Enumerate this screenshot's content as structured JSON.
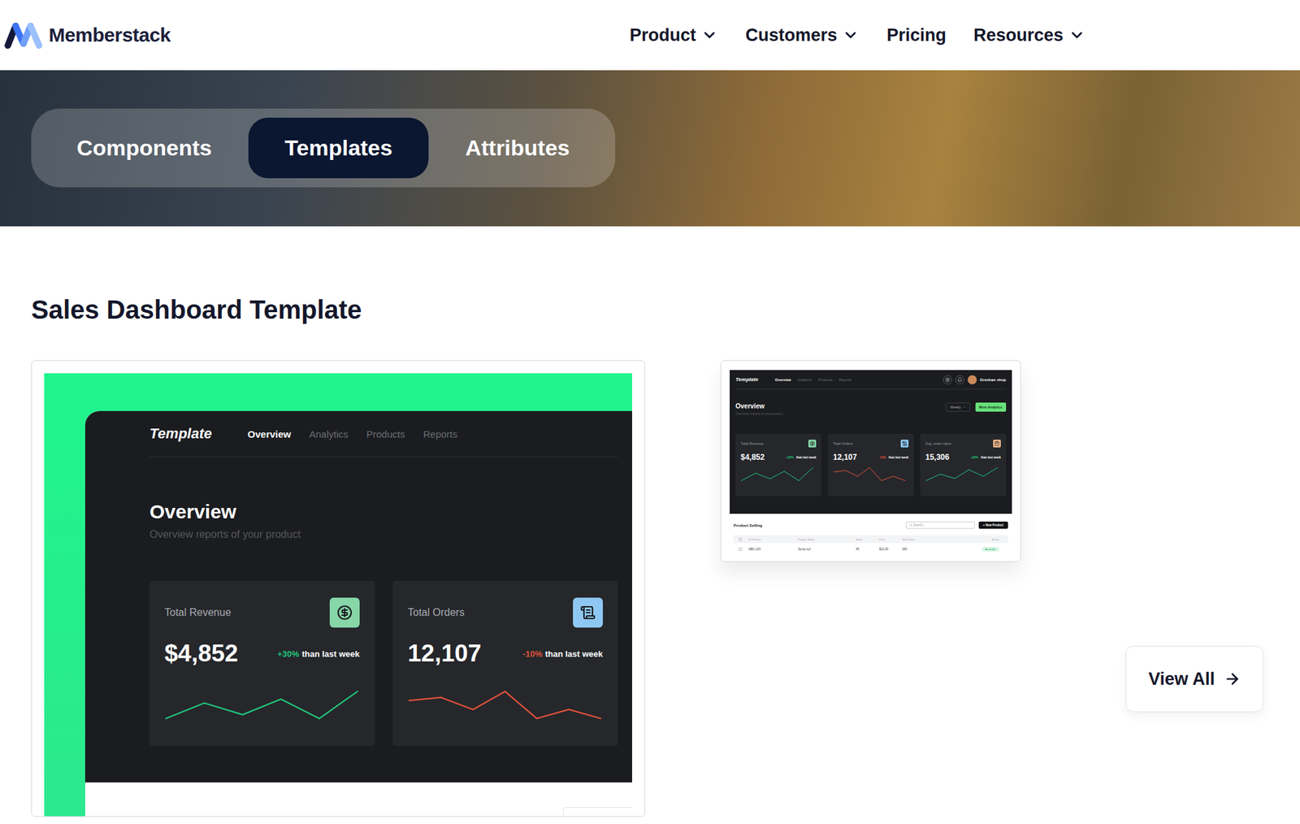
{
  "header": {
    "logo": "Memberstack",
    "nav": [
      {
        "label": "Product",
        "dropdown": true
      },
      {
        "label": "Customers",
        "dropdown": true
      },
      {
        "label": "Pricing",
        "dropdown": false
      },
      {
        "label": "Resources",
        "dropdown": true
      }
    ]
  },
  "tabs": [
    {
      "label": "Components",
      "selected": false
    },
    {
      "label": "Templates",
      "selected": true
    },
    {
      "label": "Attributes",
      "selected": false
    }
  ],
  "section_title": "Sales Dashboard Template",
  "preview": {
    "brand": "Template",
    "nav": [
      {
        "label": "Overview",
        "selected": true
      },
      {
        "label": "Analytics",
        "selected": false
      },
      {
        "label": "Products",
        "selected": false
      },
      {
        "label": "Reports",
        "selected": false
      }
    ],
    "title": "Overview",
    "subtitle": "Overview reports of your product",
    "stats": [
      {
        "label": "Total Revenue",
        "value": "$4,852",
        "change": "+30%",
        "change_note": "than last week",
        "color": "#22c57a",
        "icon_color": "#86d6a8",
        "chart": [
          2,
          6,
          3,
          7,
          2,
          9
        ]
      },
      {
        "label": "Total Orders",
        "value": "12,107",
        "change": "-10%",
        "change_note": "than last week",
        "color": "#e0523a",
        "icon_color": "#8ec8f2",
        "chart": [
          6,
          7,
          3,
          9,
          0,
          3,
          0
        ]
      }
    ]
  },
  "thumbnail": {
    "brand": "Template",
    "nav": [
      {
        "label": "Overview",
        "selected": true
      },
      {
        "label": "Analytics",
        "selected": false
      },
      {
        "label": "Products",
        "selected": false
      },
      {
        "label": "Reports",
        "selected": false
      }
    ],
    "shop": "Greshan shop",
    "title": "Overview",
    "subtitle": "Overview reports of your product",
    "filter": "Weekly",
    "action": "More Analytics",
    "stats": [
      {
        "label": "Total Revenue",
        "value": "$4,852",
        "change": "+30%",
        "change_note": "than last week",
        "color": "#22c57a",
        "icon_color": "#86d6a8",
        "chart": [
          2,
          6,
          3,
          7,
          2,
          9
        ]
      },
      {
        "label": "Total Orders",
        "value": "12,107",
        "change": "-10%",
        "change_note": "than last week",
        "color": "#e0523a",
        "icon_color": "#8ec8f2",
        "chart": [
          6,
          7,
          3,
          9,
          0,
          3,
          0
        ]
      },
      {
        "label": "Avg. order value",
        "value": "15,306",
        "change": "+20%",
        "change_note": "than last week",
        "color": "#22c57a",
        "icon_color": "#f2b78c",
        "chart": [
          2,
          5,
          3,
          7,
          4,
          8
        ]
      }
    ],
    "table": {
      "title": "Product Selling",
      "search_placeholder": "Search...",
      "button": "+ New Product",
      "columns": [
        "ID Product",
        "Product Name",
        "Stock",
        "Price",
        "Total Sales",
        "Status"
      ],
      "rows": [
        {
          "cells": [
            "ABC-12X",
            "Syrup xyz",
            "45",
            "$12,00",
            "150"
          ],
          "status": "Available",
          "checked": false
        }
      ]
    }
  },
  "view_all": {
    "label": "View All"
  }
}
